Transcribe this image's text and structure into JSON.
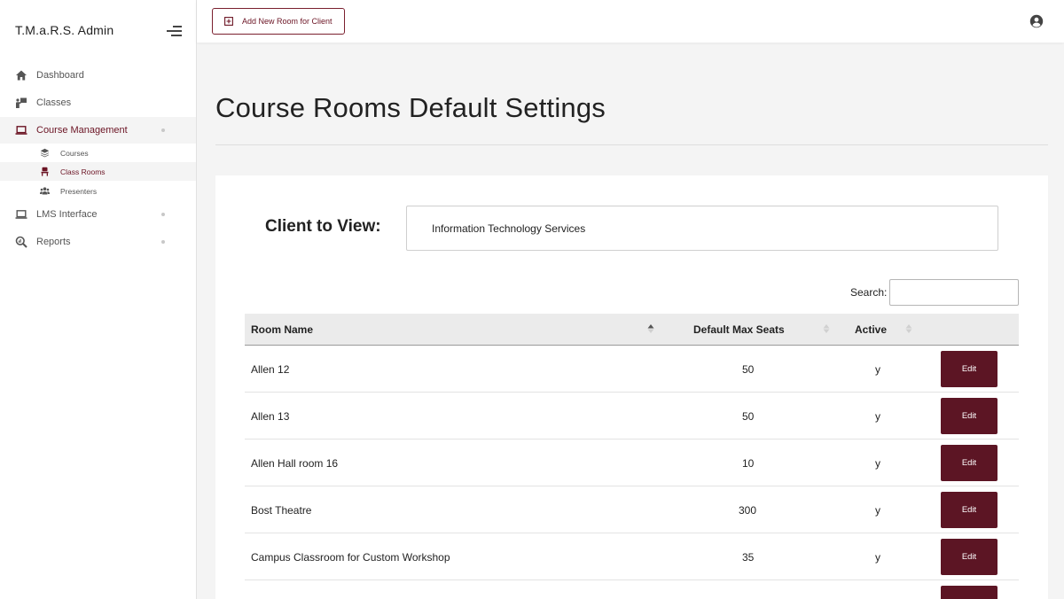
{
  "sidebar": {
    "brand": "T.M.a.R.S. Admin",
    "items": [
      {
        "label": "Dashboard",
        "icon": "home-icon"
      },
      {
        "label": "Classes",
        "icon": "classes-icon"
      },
      {
        "label": "Course Management",
        "icon": "laptop-icon",
        "active": true
      },
      {
        "label": "LMS Interface",
        "icon": "laptop-icon"
      },
      {
        "label": "Reports",
        "icon": "search-chart-icon"
      }
    ],
    "subitems": [
      {
        "label": "Courses",
        "icon": "layers-icon"
      },
      {
        "label": "Class Rooms",
        "icon": "chair-icon",
        "active": true
      },
      {
        "label": "Presenters",
        "icon": "users-icon"
      }
    ]
  },
  "topbar": {
    "add_label": "Add New Room for Client",
    "user_icon": "user-circle-icon"
  },
  "main": {
    "title": "Course Rooms Default Settings",
    "client_label": "Client to View:",
    "client_value": "Information Technology Services",
    "search_label": "Search:",
    "search_value": ""
  },
  "table": {
    "headers": [
      "Room Name",
      "Default Max Seats",
      "Active"
    ],
    "edit_label": "Edit",
    "rows": [
      {
        "name": "Allen 12",
        "seats": "50",
        "active": "y"
      },
      {
        "name": "Allen 13",
        "seats": "50",
        "active": "y"
      },
      {
        "name": "Allen Hall room 16",
        "seats": "10",
        "active": "y"
      },
      {
        "name": "Bost Theatre",
        "seats": "300",
        "active": "y"
      },
      {
        "name": "Campus Classroom for Custom Workshop",
        "seats": "35",
        "active": "y"
      },
      {
        "name": "",
        "seats": "",
        "active": ""
      }
    ]
  },
  "colors": {
    "accent": "#6b1424",
    "button": "#5c1524"
  }
}
